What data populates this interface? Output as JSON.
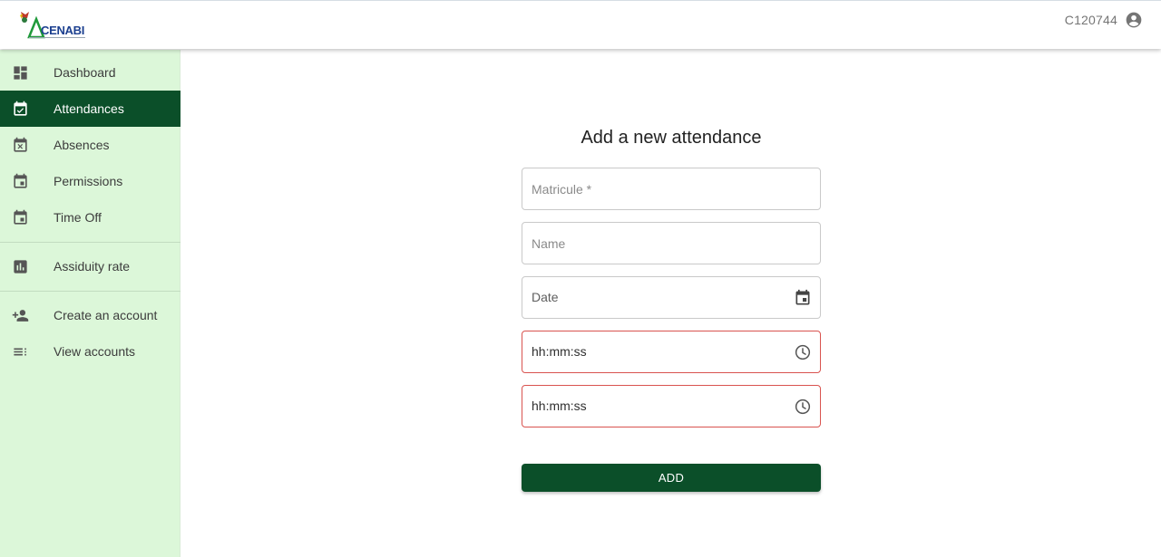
{
  "app": {
    "logo_text": "CENABI",
    "logo_icon": "cenabi-logo",
    "brand_color": "#0b4f29",
    "sidebar_color": "#dcf7d9"
  },
  "header": {
    "user_id": "C120744",
    "user_icon": "account-circle-icon"
  },
  "sidebar": {
    "items": [
      {
        "label": "Dashboard",
        "icon": "dashboard-icon"
      },
      {
        "label": "Attendances",
        "icon": "event-available-icon",
        "active": true
      },
      {
        "label": "Absences",
        "icon": "event-busy-icon"
      },
      {
        "label": "Permissions",
        "icon": "event-icon"
      },
      {
        "label": "Time Off",
        "icon": "event-icon"
      },
      {
        "label": "Assiduity rate",
        "icon": "bar-chart-icon"
      },
      {
        "label": "Create an account",
        "icon": "person-add-icon"
      },
      {
        "label": "View accounts",
        "icon": "list-icon"
      }
    ]
  },
  "form": {
    "title": "Add a new attendance",
    "fields": {
      "matricule": {
        "placeholder": "Matricule *"
      },
      "name": {
        "placeholder": "Name"
      },
      "date": {
        "label": "Date",
        "icon": "calendar-icon"
      },
      "time_in": {
        "label": "hh:mm:ss",
        "icon": "clock-icon"
      },
      "time_out": {
        "label": "hh:mm:ss",
        "icon": "clock-icon"
      }
    },
    "submit_label": "ADD",
    "error_color": "#d9534f"
  }
}
